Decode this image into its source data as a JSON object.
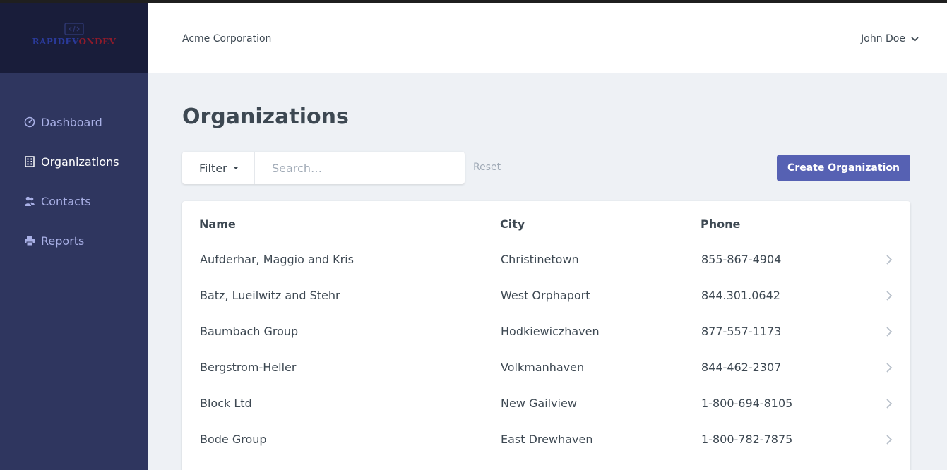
{
  "brand": {
    "logo_text_main": "RAPIDEV",
    "logo_text_accent": "ONDEV",
    "logo_icon": "code-brackets-icon"
  },
  "sidebar": {
    "items": [
      {
        "label": "Dashboard",
        "icon": "dashboard-icon",
        "active": false
      },
      {
        "label": "Organizations",
        "icon": "building-icon",
        "active": true
      },
      {
        "label": "Contacts",
        "icon": "users-icon",
        "active": false
      },
      {
        "label": "Reports",
        "icon": "printer-icon",
        "active": false
      }
    ]
  },
  "header": {
    "company": "Acme Corporation",
    "user": "John Doe"
  },
  "main": {
    "title": "Organizations",
    "filter_label": "Filter",
    "search_placeholder": "Search…",
    "reset_label": "Reset",
    "create_label": "Create Organization"
  },
  "table": {
    "columns": [
      "Name",
      "City",
      "Phone"
    ],
    "rows": [
      {
        "name": "Aufderhar, Maggio and Kris",
        "city": "Christinetown",
        "phone": "855-867-4904"
      },
      {
        "name": "Batz, Lueilwitz and Stehr",
        "city": "West Orphaport",
        "phone": "844.301.0642"
      },
      {
        "name": "Baumbach Group",
        "city": "Hodkiewiczhaven",
        "phone": "877-557-1173"
      },
      {
        "name": "Bergstrom-Heller",
        "city": "Volkmanhaven",
        "phone": "844-462-2307"
      },
      {
        "name": "Block Ltd",
        "city": "New Gailview",
        "phone": "1-800-694-8105"
      },
      {
        "name": "Bode Group",
        "city": "East Drewhaven",
        "phone": "1-800-782-7875"
      }
    ]
  },
  "colors": {
    "sidebar_bg": "#2f365f",
    "brand_bg": "#191d3a",
    "accent": "#5661b3",
    "page_bg": "#eef1f5"
  }
}
